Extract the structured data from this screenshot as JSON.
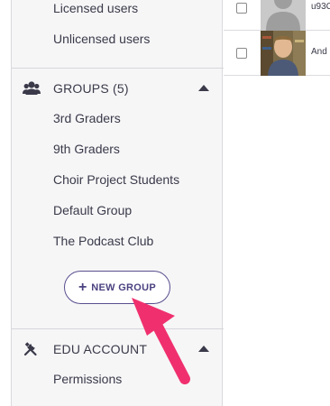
{
  "sidebar": {
    "users_items": [
      {
        "label": "Licensed users"
      },
      {
        "label": "Unlicensed users"
      }
    ],
    "groups": {
      "title": "GROUPS (5)",
      "icon": "users-icon",
      "items": [
        {
          "label": "3rd Graders"
        },
        {
          "label": "9th Graders"
        },
        {
          "label": "Choir Project Students"
        },
        {
          "label": "Default Group"
        },
        {
          "label": "The Podcast Club"
        }
      ],
      "new_group_label": "NEW GROUP"
    },
    "edu_account": {
      "title": "EDU ACCOUNT",
      "icon": "tools-icon",
      "items": [
        {
          "label": "Permissions"
        }
      ]
    }
  },
  "main": {
    "rows": [
      {
        "text": "u93C",
        "avatar": "default-avatar"
      },
      {
        "text": "And",
        "avatar": "user-photo"
      }
    ]
  },
  "colors": {
    "accent": "#4b4280",
    "arrow": "#f0306e",
    "sidebar_bg": "#f6f6f7"
  }
}
